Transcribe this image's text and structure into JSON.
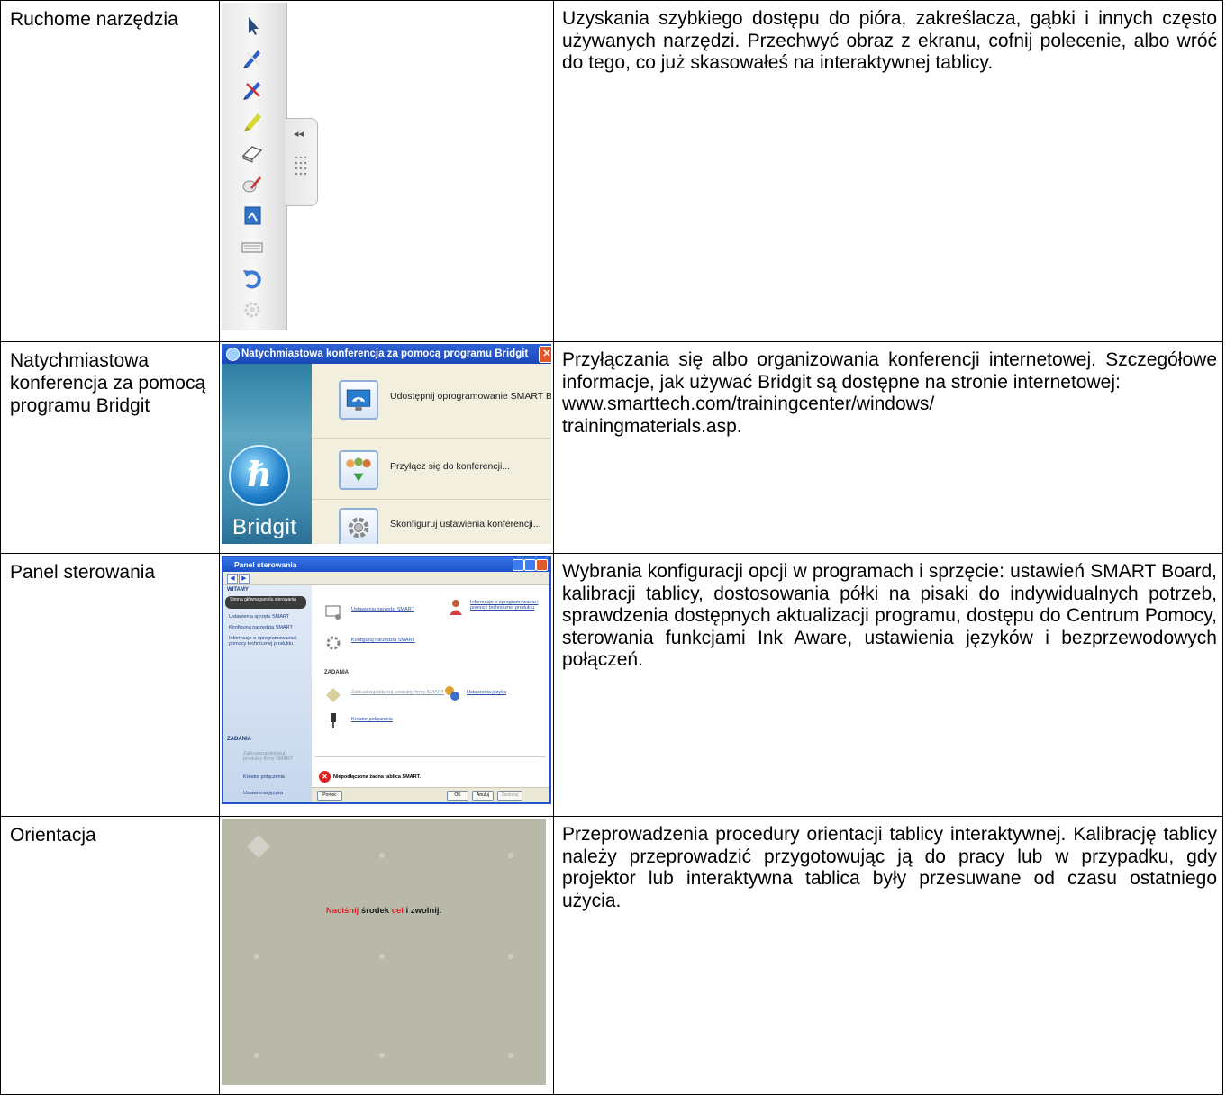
{
  "rows": [
    {
      "name": "Ruchome narzędzia",
      "description": "Uzyskania szybkiego dostępu do pióra, zakreślacza, gąbki i innych często używanych narzędzi. Przechwyć obraz z ekranu, cofnij polecenie, albo wróć do tego, co już skasowałeś na interaktywnej tablicy.",
      "toolbar_icons": [
        "arrow-pointer-icon",
        "pen-blue-icon",
        "pen-red-icon",
        "highlighter-icon",
        "eraser-icon",
        "magic-pen-icon",
        "screen-capture-icon",
        "keyboard-icon",
        "undo-icon",
        "settings-icon"
      ],
      "tab_glyph": "◂◂"
    },
    {
      "name": "Natychmiastowa konferencja za pomocą programu Bridgit",
      "description_lines": [
        "Przyłączania się albo organizowania konferencji internetowej. Szczegółowe informacje, jak używać Bridgit są dostępne na stronie internetowej:",
        "www.smarttech.com/trainingcenter/windows/",
        "trainingmaterials.asp."
      ],
      "bridgit": {
        "title": "Natychmiastowa konferencja za pomocą programu Bridgit",
        "close": "✕",
        "brand": "Bridgit",
        "options": [
          {
            "label": "Udostępnij oprogramowanie SMART Board...",
            "icon": "share-screen-icon"
          },
          {
            "label": "Przyłącz się do konferencji...",
            "icon": "join-conference-icon"
          },
          {
            "label": "Skonfiguruj ustawienia konferencji...",
            "icon": "gear-icon"
          }
        ]
      }
    },
    {
      "name": "Panel sterowania",
      "description": "Wybrania konfiguracji opcji w programach i sprzęcie: ustawień SMART Board, kalibracji tablicy, dostosowania półki na pisaki do indywidualnych potrzeb, sprawdzenia dostępnych aktualizacji programu, dostępu do Centrum Pomocy, sterowania funkcjami Ink Aware, ustawienia języków i bezprzewodowych połączeń.",
      "panel": {
        "title": "Panel sterowania",
        "side_header": "WITAMY",
        "side_selected": "Strona główna panelu sterowania",
        "side_items": [
          "Ustawienia sprzętu SMART",
          "Konfiguruj narzędzia SMART",
          "Informacje o oprogramowaniu i pomocy technicznej produktu"
        ],
        "side_tasks_header": "ZADANIA",
        "side_tasks": [
          "Zaktualizuj/aktywuj produkty firmy SMART",
          "Kreator połączenia",
          "Ustawienia języka"
        ],
        "main_items": [
          "Ustawienia narzędzi SMART",
          "Informacje o oprogramowaniu i pomocy technicznej produktu",
          "Konfiguruj narzędzia SMART"
        ],
        "tasks_header": "ZADANIA",
        "task_items": [
          "Zaktualizuj/aktywuj produkty firmy SMART",
          "Ustawienia języka",
          "Kreator połączenia"
        ],
        "error": "Niepodłączona żadna tablica SMART.",
        "buttons": [
          "Pomoc",
          "OK",
          "Anuluj",
          "Zastosuj"
        ]
      }
    },
    {
      "name": "Orientacja",
      "description": "Przeprowadzenia procedury orientacji tablicy interaktywnej. Kalibrację tablicy należy przeprowadzić przygotowując ją do pracy lub w przypadku, gdy projektor lub interaktywna tablica były przesuwane od czasu ostatniego użycia.",
      "orient_msg": {
        "before": "Naciśnij",
        "mid": " środek ",
        "red2": "cel",
        "after": " i zwolnij."
      }
    }
  ]
}
